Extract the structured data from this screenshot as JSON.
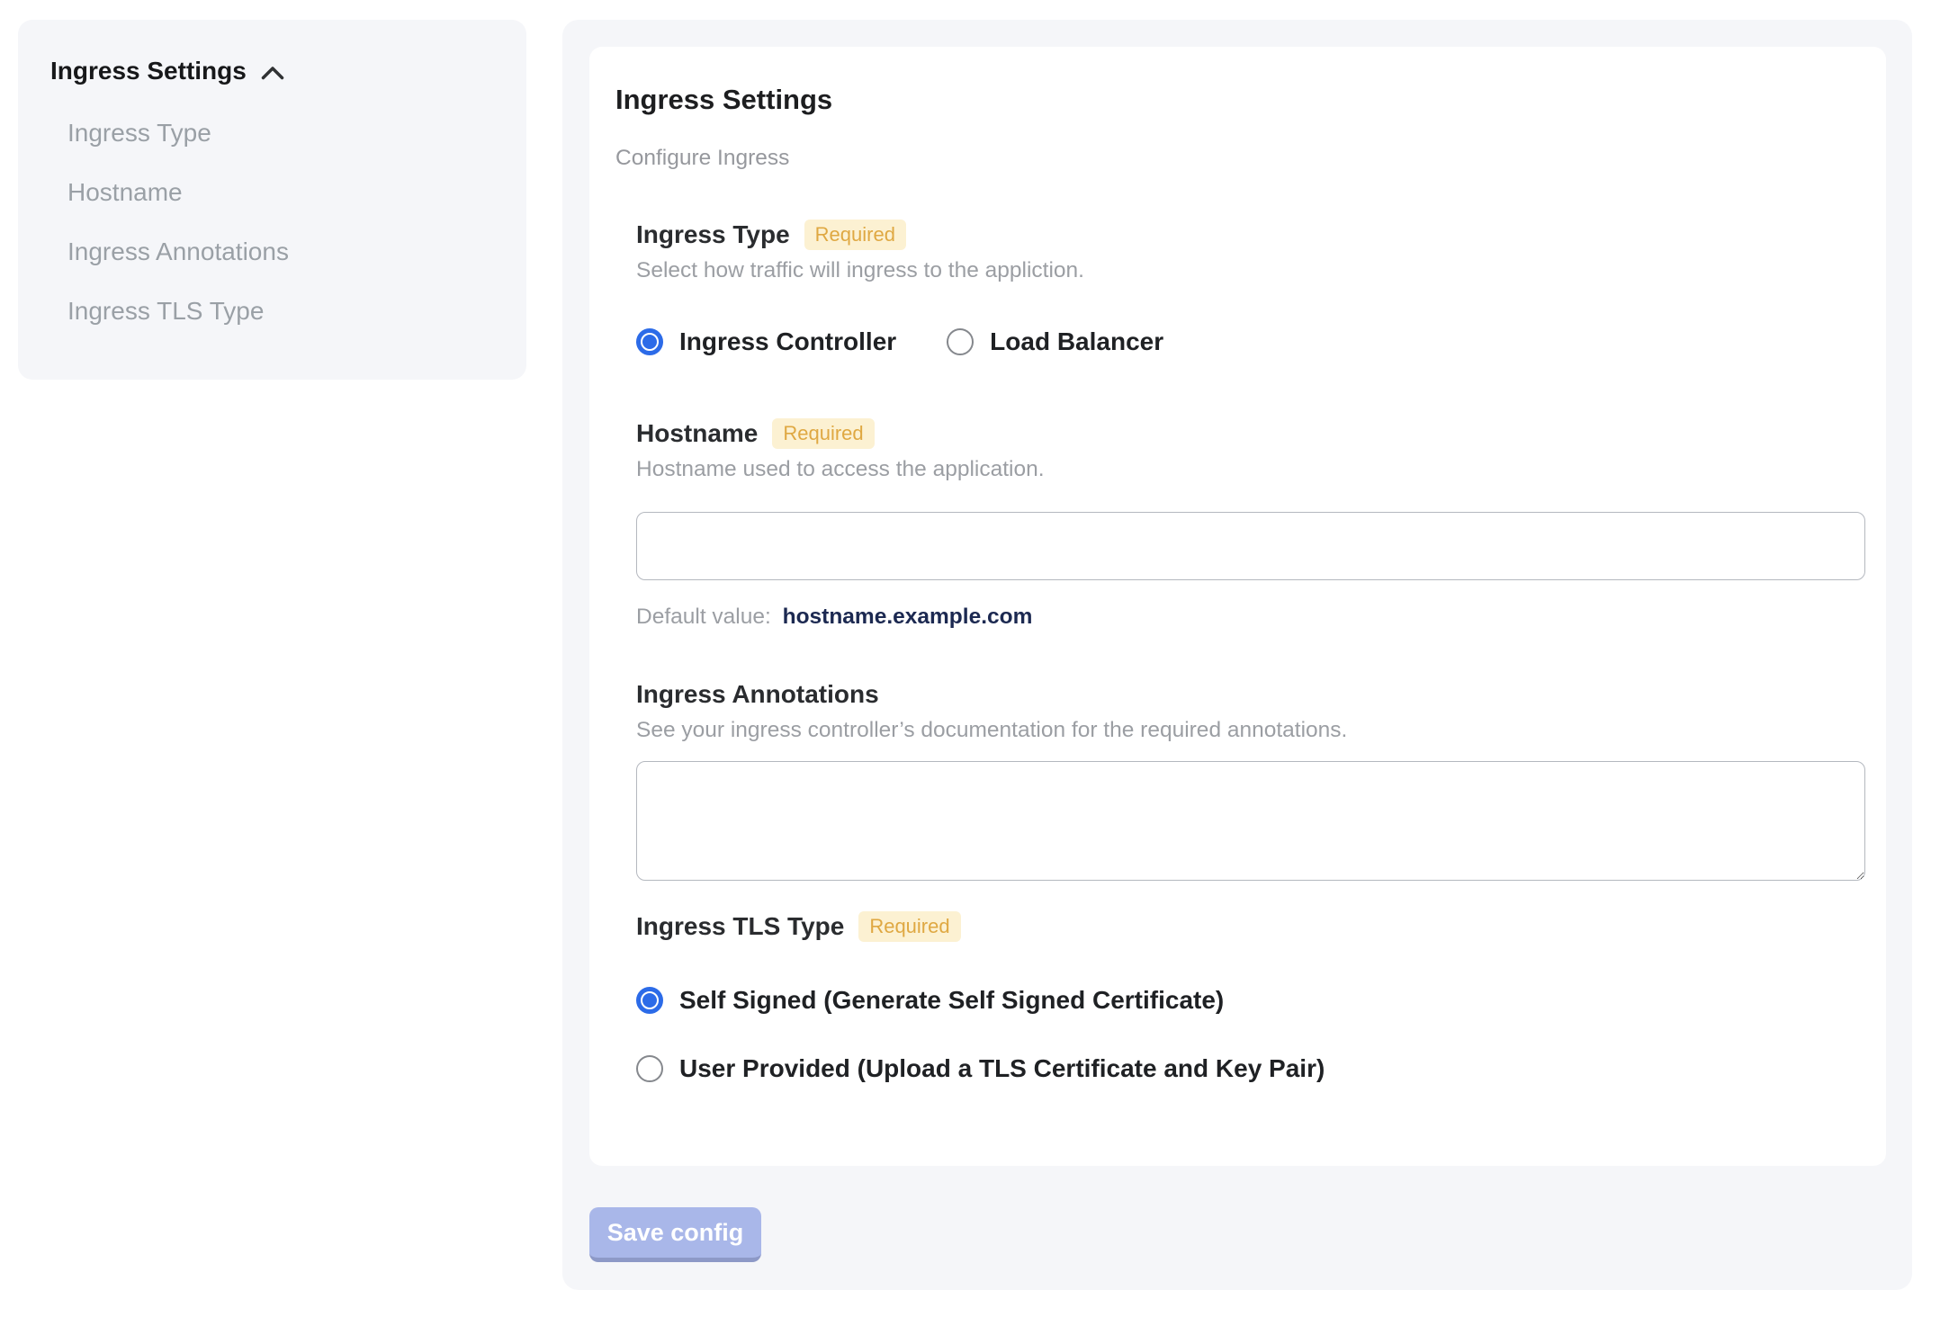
{
  "sidebar": {
    "header": "Ingress Settings",
    "chevron_icon": "chevron-up-icon",
    "items": [
      {
        "label": "Ingress Type"
      },
      {
        "label": "Hostname"
      },
      {
        "label": "Ingress Annotations"
      },
      {
        "label": "Ingress TLS Type"
      }
    ]
  },
  "main": {
    "title": "Ingress Settings",
    "subtitle": "Configure Ingress",
    "sections": {
      "ingress_type": {
        "title": "Ingress Type",
        "required": "Required",
        "description": "Select how traffic will ingress to the appliction.",
        "options": [
          {
            "label": "Ingress Controller",
            "selected": true
          },
          {
            "label": "Load Balancer",
            "selected": false
          }
        ]
      },
      "hostname": {
        "title": "Hostname",
        "required": "Required",
        "description": "Hostname used to access the application.",
        "value": "",
        "default_label": "Default value:",
        "default_value": "hostname.example.com"
      },
      "annotations": {
        "title": "Ingress Annotations",
        "description": "See your ingress controller’s documentation for the required annotations.",
        "value": ""
      },
      "tls": {
        "title": "Ingress TLS Type",
        "required": "Required",
        "options": [
          {
            "label": "Self Signed (Generate Self Signed Certificate)",
            "selected": true
          },
          {
            "label": "User Provided (Upload a TLS Certificate and Key Pair)",
            "selected": false
          }
        ]
      }
    },
    "save_button_label": "Save config"
  },
  "colors": {
    "accent_blue": "#2c6be8",
    "required_badge_bg": "#fcf1d2",
    "required_badge_text": "#dfa842",
    "panel_bg": "#f5f6f9",
    "save_button_bg": "#a9b7e9",
    "save_button_edge": "#8d99c7",
    "default_value_text": "#1c2951",
    "muted_text": "#9b9ea3"
  }
}
